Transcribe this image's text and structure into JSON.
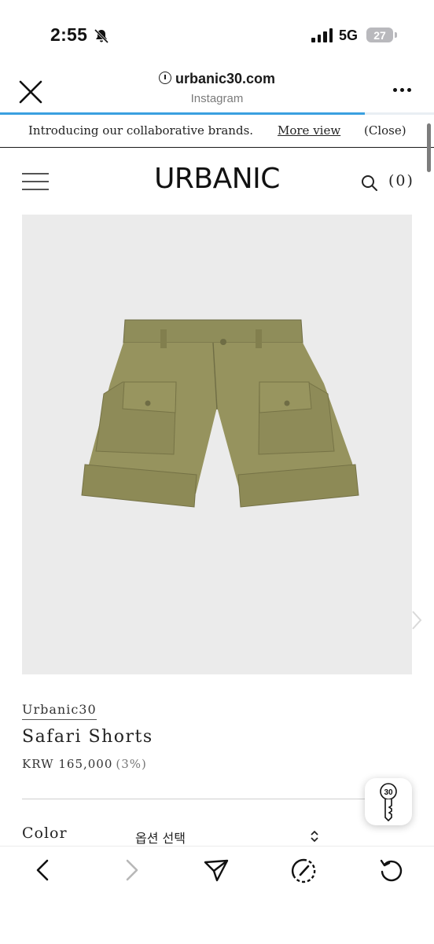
{
  "status_bar": {
    "time": "2:55",
    "network": "5G",
    "battery": "27"
  },
  "browser": {
    "url": "urbanic30.com",
    "source": "Instagram",
    "load_progress": 0.84
  },
  "announcement": {
    "text": "Introducing our collaborative brands.",
    "more_link": "More view",
    "close_link": "(Close)"
  },
  "site": {
    "logo": "URBANIC",
    "cart_count": "(0)"
  },
  "product": {
    "brand": "Urbanic30",
    "name": "Safari Shorts",
    "price": "KRW 165,000",
    "discount": "(3%)",
    "color_label": "Color",
    "option_placeholder": "옵션 선택"
  },
  "icons": {
    "close": "close-icon",
    "more": "more-icon",
    "menu": "hamburger-icon",
    "search": "search-icon",
    "next": "chevron-right-icon",
    "key": "key-icon",
    "back": "back-arrow-icon",
    "forward": "forward-arrow-icon",
    "share": "share-icon",
    "speed": "speed-icon",
    "reload": "reload-icon"
  }
}
